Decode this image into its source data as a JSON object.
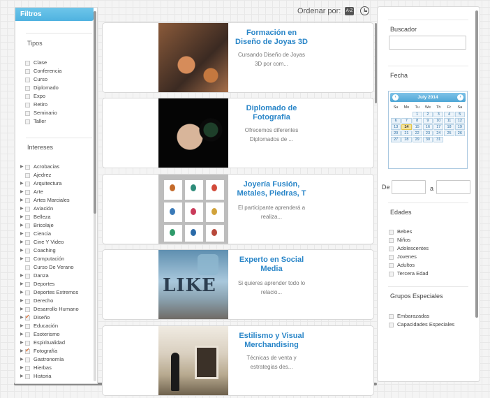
{
  "sidebar": {
    "header": "Filtros",
    "tipos_title": "Tipos",
    "tipos": [
      {
        "label": "Clase",
        "checked": false
      },
      {
        "label": "Conferencia",
        "checked": false
      },
      {
        "label": "Curso",
        "checked": false
      },
      {
        "label": "Diplomado",
        "checked": false
      },
      {
        "label": "Expo",
        "checked": false
      },
      {
        "label": "Retiro",
        "checked": false
      },
      {
        "label": "Seminario",
        "checked": false
      },
      {
        "label": "Taller",
        "checked": false
      }
    ],
    "intereses_title": "Intereses",
    "intereses": [
      {
        "label": "Acrobacias",
        "checked": false,
        "expandable": true
      },
      {
        "label": "Ajedrez",
        "checked": false,
        "expandable": false
      },
      {
        "label": "Arquitectura",
        "checked": false,
        "expandable": true
      },
      {
        "label": "Arte",
        "checked": false,
        "expandable": true
      },
      {
        "label": "Artes Marciales",
        "checked": false,
        "expandable": true
      },
      {
        "label": "Aviación",
        "checked": false,
        "expandable": true
      },
      {
        "label": "Belleza",
        "checked": false,
        "expandable": true
      },
      {
        "label": "Bricolaje",
        "checked": false,
        "expandable": true
      },
      {
        "label": "Ciencia",
        "checked": false,
        "expandable": true
      },
      {
        "label": "Cine Y Video",
        "checked": false,
        "expandable": true
      },
      {
        "label": "Coaching",
        "checked": false,
        "expandable": true
      },
      {
        "label": "Computación",
        "checked": false,
        "expandable": true
      },
      {
        "label": "Curso De Verano",
        "checked": false,
        "expandable": false
      },
      {
        "label": "Danza",
        "checked": false,
        "expandable": true
      },
      {
        "label": "Deportes",
        "checked": false,
        "expandable": true
      },
      {
        "label": "Deportes Extremos",
        "checked": false,
        "expandable": true
      },
      {
        "label": "Derecho",
        "checked": false,
        "expandable": true
      },
      {
        "label": "Desarrollo Humano",
        "checked": false,
        "expandable": true
      },
      {
        "label": "Diseño",
        "checked": true,
        "expandable": true
      },
      {
        "label": "Educación",
        "checked": false,
        "expandable": true
      },
      {
        "label": "Esoterismo",
        "checked": false,
        "expandable": true
      },
      {
        "label": "Espiritualidad",
        "checked": false,
        "expandable": true
      },
      {
        "label": "Fotografía",
        "checked": true,
        "expandable": true
      },
      {
        "label": "Gastronomía",
        "checked": false,
        "expandable": true
      },
      {
        "label": "Hierbas",
        "checked": false,
        "expandable": true
      },
      {
        "label": "Historia",
        "checked": false,
        "expandable": true
      }
    ]
  },
  "sort": {
    "label": "Ordenar por:",
    "az_icon_text": "A-Z"
  },
  "cards": [
    {
      "title": "Formación en Diseño de Joyas 3D",
      "desc": "Cursando Diseño de Joyas 3D por com..."
    },
    {
      "title": "Diplomado de Fotografia",
      "desc": "Ofrecemos diferentes Diplomados de ..."
    },
    {
      "title": "Joyería Fusión, Metales, Piedras, T",
      "desc": "El participante aprenderá a realiza..."
    },
    {
      "title": "Experto en Social Media",
      "desc": "Si quieres aprender todo lo relacio..."
    },
    {
      "title": "Estilismo y Visual Merchandising",
      "desc": "Técnicas de venta y estrategias des..."
    }
  ],
  "card_images": {
    "card4_text": "LIKE"
  },
  "right": {
    "buscador_title": "Buscador",
    "fecha_title": "Fecha",
    "calendar": {
      "month": "July 2014",
      "prev": "‹",
      "next": "›",
      "weekdays": [
        "Su",
        "Mo",
        "Tu",
        "We",
        "Th",
        "Fr",
        "Sa"
      ],
      "weeks": [
        [
          "",
          "",
          "1",
          "2",
          "3",
          "4",
          "5"
        ],
        [
          "6",
          "7",
          "8",
          "9",
          "10",
          "11",
          "12"
        ],
        [
          "13",
          "14",
          "15",
          "16",
          "17",
          "18",
          "19"
        ],
        [
          "20",
          "21",
          "22",
          "23",
          "24",
          "25",
          "26"
        ],
        [
          "27",
          "28",
          "29",
          "30",
          "31",
          "",
          ""
        ]
      ],
      "today": "14"
    },
    "de_label": "De",
    "a_label": "a",
    "edades_title": "Edades",
    "edades": [
      "Bebes",
      "Niños",
      "Adolescentes",
      "Jovenes",
      "Adultos",
      "Tercera Edad"
    ],
    "grupos_title": "Grupos Especiales",
    "grupos": [
      "Embarazadas",
      "Capacidades Especiales"
    ]
  }
}
